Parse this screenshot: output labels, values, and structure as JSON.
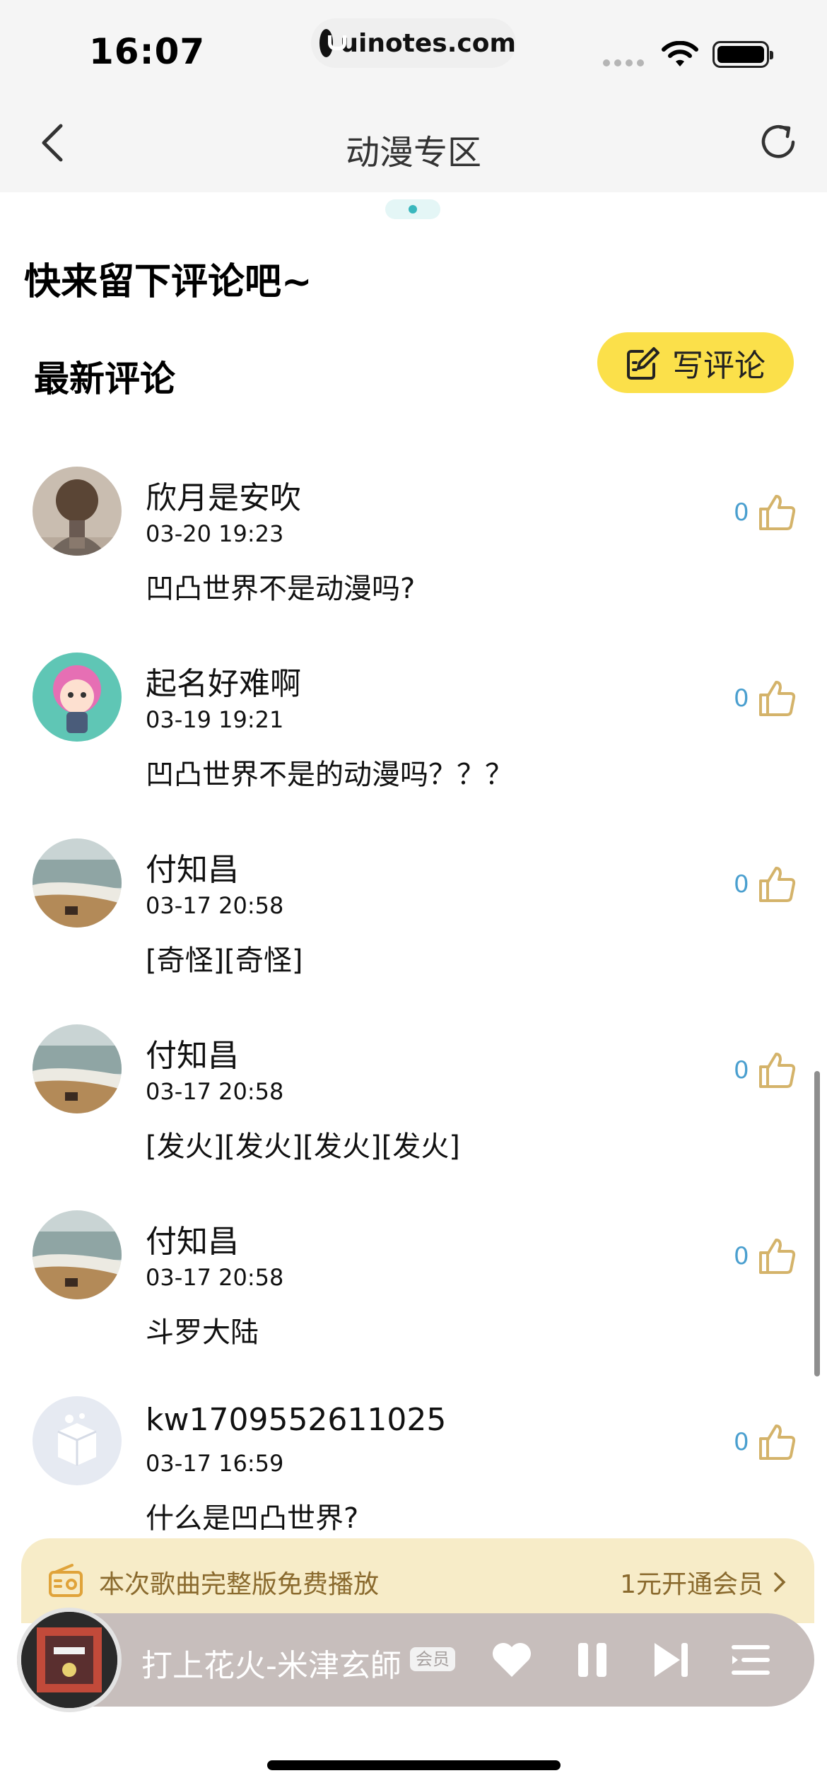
{
  "status_bar": {
    "time": "16:07",
    "url": "uinotes.com"
  },
  "nav": {
    "title": "动漫专区"
  },
  "headline": "快来留下评论吧~",
  "section": {
    "title": "最新评论",
    "write_label": "写评论"
  },
  "comments": [
    {
      "name": "欣月是安吹",
      "time": "03-20 19:23",
      "text": "凹凸世界不是动漫吗?",
      "likes": "0"
    },
    {
      "name": "起名好难啊",
      "time": "03-19 19:21",
      "text": "凹凸世界不是的动漫吗？？？",
      "likes": "0"
    },
    {
      "name": "付知昌",
      "time": "03-17 20:58",
      "text": "[奇怪][奇怪]",
      "likes": "0"
    },
    {
      "name": "付知昌",
      "time": "03-17 20:58",
      "text": "[发火][发火][发火][发火]",
      "likes": "0"
    },
    {
      "name": "付知昌",
      "time": "03-17 20:58",
      "text": "斗罗大陆",
      "likes": "0"
    },
    {
      "name": "kw1709552611025",
      "time": "03-17 16:59",
      "text": "什么是凹凸世界?",
      "likes": "0"
    }
  ],
  "player": {
    "promo_text": "本次歌曲完整版免费播放",
    "vip_link": "1元开通会员",
    "song_title": "打上花火-米津玄師",
    "vip_badge": "会员"
  },
  "colors": {
    "accent_yellow": "#fbe04a",
    "like_count": "#4a9fcf",
    "like_icon": "#d4b36a"
  }
}
